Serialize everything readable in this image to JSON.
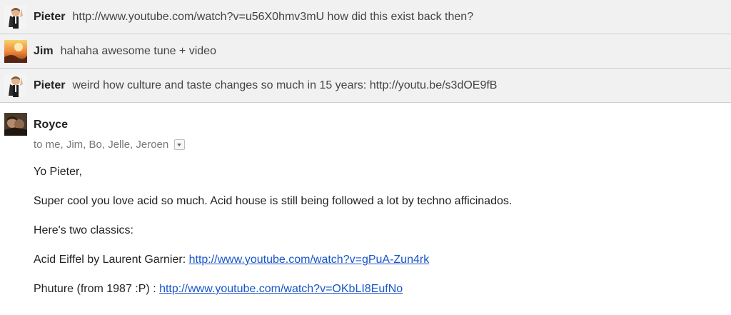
{
  "thread": [
    {
      "sender": "Pieter",
      "snippet": "http://www.youtube.com/watch?v=u56X0hmv3mU how did this exist back then?",
      "avatar": "pieter-avatar"
    },
    {
      "sender": "Jim",
      "snippet": "hahaha awesome tune + video",
      "avatar": "jim-avatar"
    },
    {
      "sender": "Pieter",
      "snippet": "weird how culture and taste changes so much in 15 years: http://youtu.be/s3dOE9fB",
      "avatar": "pieter-avatar"
    }
  ],
  "open_message": {
    "sender": "Royce",
    "recipients": "to me, Jim, Bo, Jelle, Jeroen",
    "greeting": "Yo Pieter,",
    "paragraph1": "Super cool you love acid so much. Acid house is still being followed a lot by techno afficinados.",
    "paragraph2": "Here's two classics:",
    "classic1_label": "Acid Eiffel by Laurent Garnier: ",
    "classic1_link": "http://www.youtube.com/watch?v=gPuA-Zun4rk",
    "classic2_label": "Phuture (from 1987 :P) : ",
    "classic2_link": "http://www.youtube.com/watch?v=OKbLI8EufNo"
  }
}
